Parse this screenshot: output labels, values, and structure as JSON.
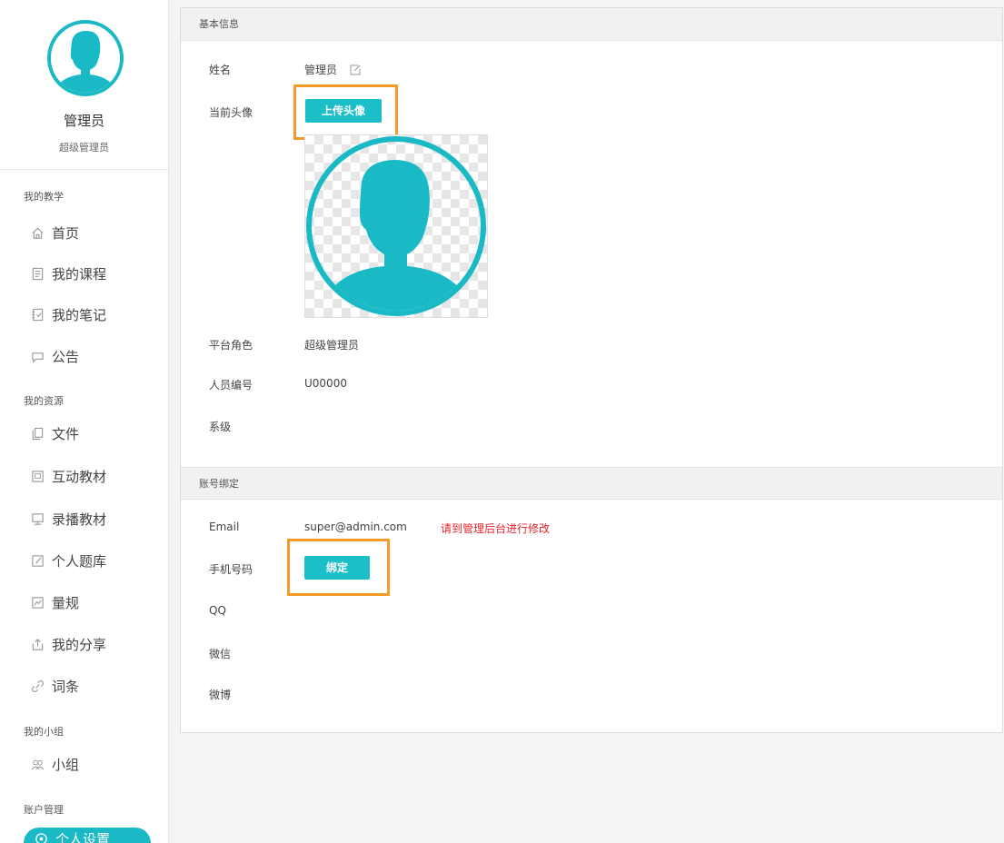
{
  "user": {
    "name": "管理员",
    "role": "超级管理员"
  },
  "sidebar": {
    "groups": [
      {
        "title": "我的教学",
        "items": [
          {
            "label": "首页",
            "icon": "home-icon"
          },
          {
            "label": "我的课程",
            "icon": "course-icon"
          },
          {
            "label": "我的笔记",
            "icon": "notebook-icon"
          },
          {
            "label": "公告",
            "icon": "announcement-icon"
          }
        ]
      },
      {
        "title": "我的资源",
        "items": [
          {
            "label": "文件",
            "icon": "file-icon"
          },
          {
            "label": "互动教材",
            "icon": "interactive-material-icon"
          },
          {
            "label": "录播教材",
            "icon": "recorded-material-icon"
          },
          {
            "label": "个人题库",
            "icon": "question-bank-icon"
          },
          {
            "label": "量规",
            "icon": "rubric-icon"
          },
          {
            "label": "我的分享",
            "icon": "share-icon"
          },
          {
            "label": "词条",
            "icon": "link-icon"
          }
        ]
      },
      {
        "title": "我的小组",
        "items": [
          {
            "label": "小组",
            "icon": "group-icon"
          }
        ]
      },
      {
        "title": "账户管理",
        "items": [
          {
            "label": "个人设置",
            "icon": "settings-icon",
            "active": true
          }
        ]
      }
    ]
  },
  "basic_info": {
    "section_title": "基本信息",
    "name_label": "姓名",
    "name_value": "管理员",
    "avatar_label": "当前头像",
    "upload_button": "上传头像",
    "role_label": "平台角色",
    "role_value": "超级管理员",
    "id_label": "人员编号",
    "id_value": "U00000",
    "dept_label": "系级",
    "dept_value": ""
  },
  "binding": {
    "section_title": "账号绑定",
    "email_label": "Email",
    "email_value": "super@admin.com",
    "email_notice": "请到管理后台进行修改",
    "phone_label": "手机号码",
    "phone_button": "绑定",
    "qq_label": "QQ",
    "wechat_label": "微信",
    "weibo_label": "微博"
  },
  "colors": {
    "accent": "#1bbfc8",
    "highlight": "#f39a29",
    "warning": "#e8242c"
  }
}
